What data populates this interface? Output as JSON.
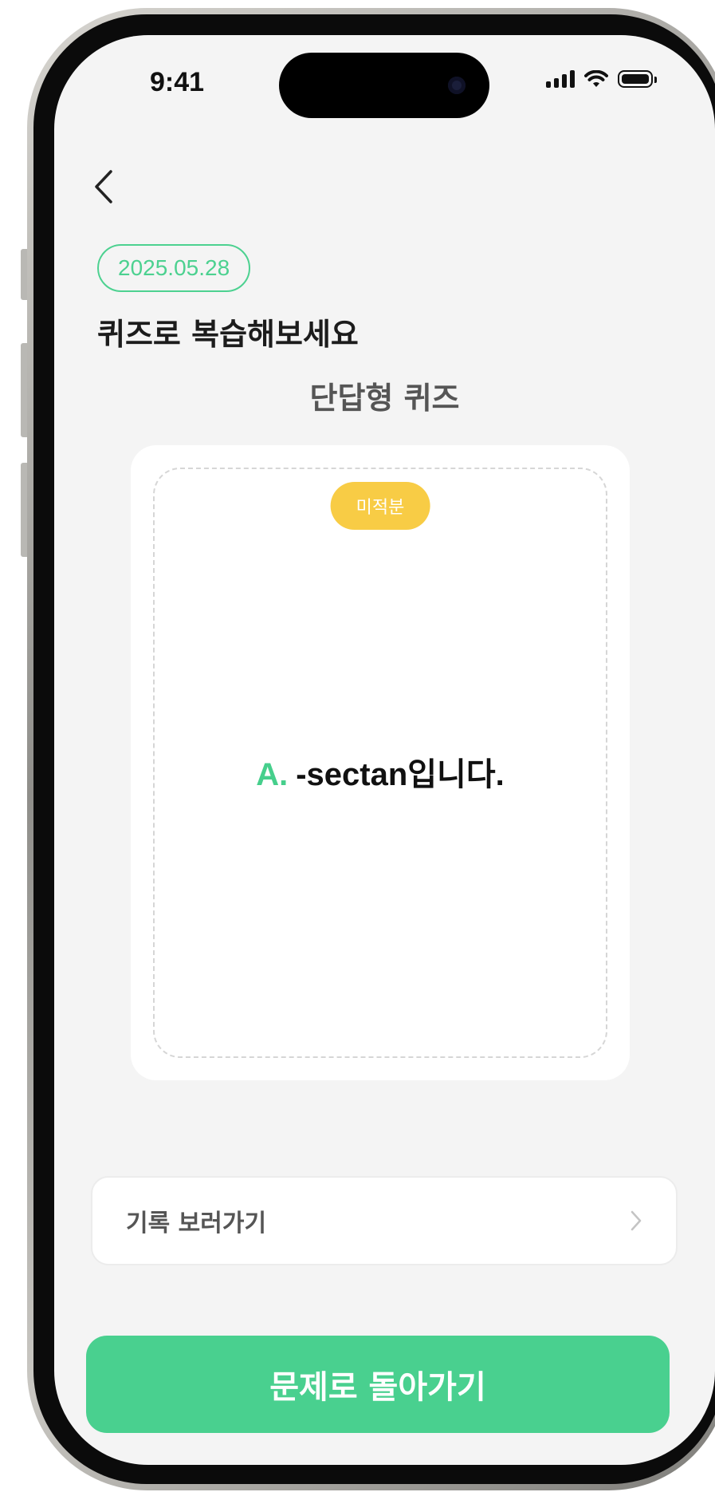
{
  "status_bar": {
    "time": "9:41",
    "icons": [
      "cellular-signal-icon",
      "wifi-icon",
      "battery-icon"
    ]
  },
  "nav": {
    "back_icon": "chevron-left-icon"
  },
  "header": {
    "date": "2025.05.28",
    "title": "퀴즈로 복습해보세요"
  },
  "quiz": {
    "type_label": "단답형 퀴즈",
    "tag": "미적분",
    "answer_prefix": "A.",
    "answer_text": "-sectan입니다."
  },
  "history": {
    "label": "기록 보러가기",
    "icon": "chevron-right-icon"
  },
  "cta": {
    "label": "문제로 돌아가기"
  },
  "colors": {
    "accent_green": "#49d08f",
    "tag_yellow": "#f8cc45",
    "screen_bg": "#f4f4f4"
  }
}
